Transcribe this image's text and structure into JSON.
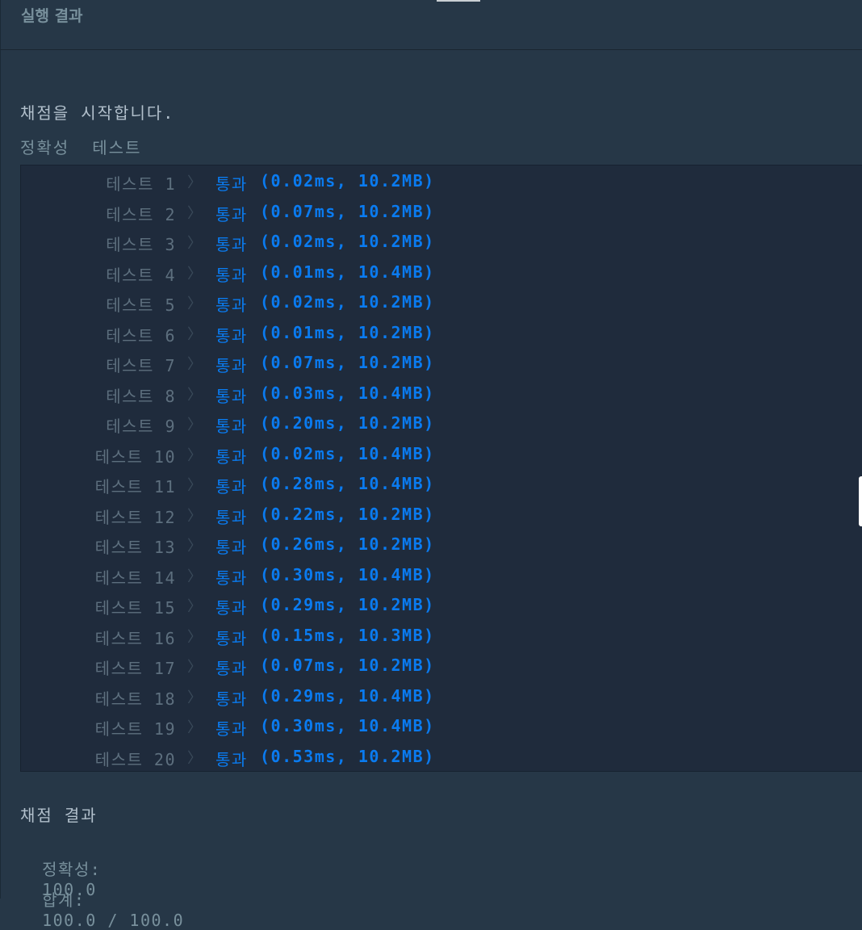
{
  "header": {
    "title": "실행 결과"
  },
  "output": {
    "start_message": "채점을 시작합니다.",
    "section_label": "정확성  테스트",
    "chevron": "〉",
    "tests": [
      {
        "label": "테스트 1",
        "status": "통과",
        "metric": "(0.02ms, 10.2MB)"
      },
      {
        "label": "테스트 2",
        "status": "통과",
        "metric": "(0.07ms, 10.2MB)"
      },
      {
        "label": "테스트 3",
        "status": "통과",
        "metric": "(0.02ms, 10.2MB)"
      },
      {
        "label": "테스트 4",
        "status": "통과",
        "metric": "(0.01ms, 10.4MB)"
      },
      {
        "label": "테스트 5",
        "status": "통과",
        "metric": "(0.02ms, 10.2MB)"
      },
      {
        "label": "테스트 6",
        "status": "통과",
        "metric": "(0.01ms, 10.2MB)"
      },
      {
        "label": "테스트 7",
        "status": "통과",
        "metric": "(0.07ms, 10.2MB)"
      },
      {
        "label": "테스트 8",
        "status": "통과",
        "metric": "(0.03ms, 10.4MB)"
      },
      {
        "label": "테스트 9",
        "status": "통과",
        "metric": "(0.20ms, 10.2MB)"
      },
      {
        "label": "테스트 10",
        "status": "통과",
        "metric": "(0.02ms, 10.4MB)"
      },
      {
        "label": "테스트 11",
        "status": "통과",
        "metric": "(0.28ms, 10.4MB)"
      },
      {
        "label": "테스트 12",
        "status": "통과",
        "metric": "(0.22ms, 10.2MB)"
      },
      {
        "label": "테스트 13",
        "status": "통과",
        "metric": "(0.26ms, 10.2MB)"
      },
      {
        "label": "테스트 14",
        "status": "통과",
        "metric": "(0.30ms, 10.4MB)"
      },
      {
        "label": "테스트 15",
        "status": "통과",
        "metric": "(0.29ms, 10.2MB)"
      },
      {
        "label": "테스트 16",
        "status": "통과",
        "metric": "(0.15ms, 10.3MB)"
      },
      {
        "label": "테스트 17",
        "status": "통과",
        "metric": "(0.07ms, 10.2MB)"
      },
      {
        "label": "테스트 18",
        "status": "통과",
        "metric": "(0.29ms, 10.4MB)"
      },
      {
        "label": "테스트 19",
        "status": "통과",
        "metric": "(0.30ms, 10.4MB)"
      },
      {
        "label": "테스트 20",
        "status": "통과",
        "metric": "(0.53ms, 10.2MB)"
      }
    ],
    "summary_title": "채점 결과",
    "accuracy_label": "정확성:",
    "accuracy_value": "100.0",
    "total_label": "합계:",
    "total_value": "100.0 / 100.0"
  },
  "colors": {
    "background": "#263747",
    "results_background": "#1f2b3c",
    "pass": "#0a7bf0",
    "muted_text": "#78909c"
  }
}
